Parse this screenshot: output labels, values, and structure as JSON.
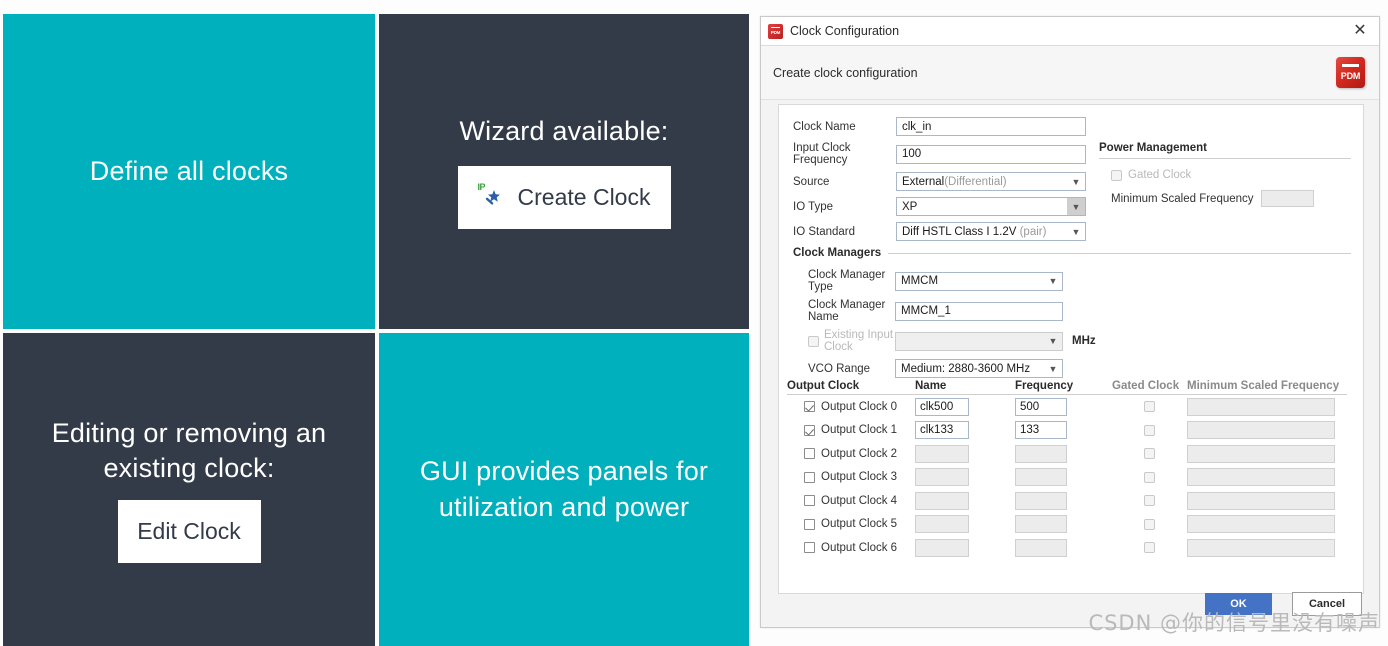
{
  "slides": {
    "define": {
      "text": "Define all clocks"
    },
    "wizard": {
      "text": "Wizard available:",
      "button_label": "Create Clock",
      "button_icon": "ip-wand-icon",
      "icon_tag": "IP"
    },
    "editing": {
      "text": "Editing or removing an existing clock:",
      "button_label": "Edit Clock"
    },
    "gui": {
      "text": "GUI provides panels for utilization and power"
    }
  },
  "dialog": {
    "title": "Clock Configuration",
    "title_icon": "pdm-icon",
    "close_icon": "✕",
    "subheader": "Create clock configuration",
    "logo_text": "PDM",
    "clock_fields": [
      {
        "label": "Clock Name",
        "type": "text",
        "value": "clk_in"
      },
      {
        "label": "Input Clock Frequency",
        "type": "text",
        "value": "100"
      },
      {
        "label": "Source",
        "type": "select",
        "value": "External",
        "value_muted": "(Differential)"
      },
      {
        "label": "IO Type",
        "type": "select",
        "value": "XP",
        "value_muted": ""
      },
      {
        "label": "IO Standard",
        "type": "select",
        "value": "Diff HSTL Class I 1.2V",
        "value_muted": " (pair)"
      }
    ],
    "power_management": {
      "title": "Power Management",
      "gated_clock_label": "Gated Clock",
      "gated_clock_checked": false,
      "min_scaled_frequency_label": "Minimum Scaled Frequency",
      "min_scaled_frequency_value": ""
    },
    "clock_managers": {
      "title": "Clock Managers",
      "rows": [
        {
          "label": "Clock Manager Type",
          "type": "select",
          "value": "MMCM"
        },
        {
          "label": "Clock Manager Name",
          "type": "text",
          "value": "MMCM_1"
        },
        {
          "label": "Existing Input Clock",
          "type": "checkbox-select",
          "value": "",
          "suffix": "MHz",
          "disabled": true
        },
        {
          "label": "VCO Range",
          "type": "select",
          "value": "Medium: 2880-3600 MHz"
        }
      ]
    },
    "output_clocks": {
      "headers": {
        "output_clock": "Output Clock",
        "name": "Name",
        "frequency": "Frequency",
        "gated_clock": "Gated Clock",
        "min_scaled_frequency": "Minimum Scaled Frequency"
      },
      "rows": [
        {
          "label": "Output Clock 0",
          "checked": true,
          "name": "clk500",
          "frequency": "500",
          "gated": false,
          "min_scaled_frequency": ""
        },
        {
          "label": "Output Clock 1",
          "checked": true,
          "name": "clk133",
          "frequency": "133",
          "gated": false,
          "min_scaled_frequency": ""
        },
        {
          "label": "Output Clock 2",
          "checked": false,
          "name": "",
          "frequency": "",
          "gated": false,
          "min_scaled_frequency": ""
        },
        {
          "label": "Output Clock 3",
          "checked": false,
          "name": "",
          "frequency": "",
          "gated": false,
          "min_scaled_frequency": ""
        },
        {
          "label": "Output Clock 4",
          "checked": false,
          "name": "",
          "frequency": "",
          "gated": false,
          "min_scaled_frequency": ""
        },
        {
          "label": "Output Clock 5",
          "checked": false,
          "name": "",
          "frequency": "",
          "gated": false,
          "min_scaled_frequency": ""
        },
        {
          "label": "Output Clock 6",
          "checked": false,
          "name": "",
          "frequency": "",
          "gated": false,
          "min_scaled_frequency": ""
        }
      ]
    },
    "footer": {
      "ok_label": "OK",
      "cancel_label": "Cancel"
    }
  },
  "watermark": {
    "text": "CSDN @你的信号里没有噪声"
  },
  "colors": {
    "teal": "#00b0bd",
    "dark": "#333b49",
    "accent_blue": "#4472c4",
    "brand_red": "#c9211e"
  }
}
